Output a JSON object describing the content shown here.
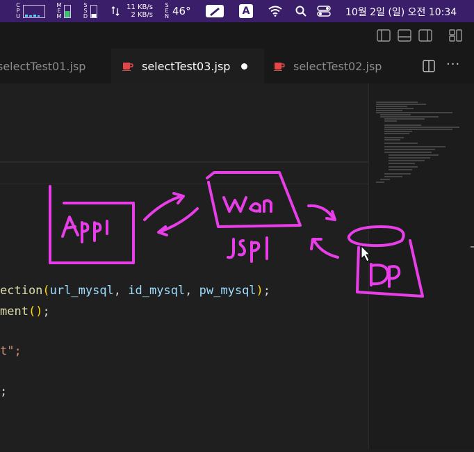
{
  "menubar": {
    "cpu_label": "CPU",
    "mem_label": "MEM",
    "ssd_label": "SSD",
    "net_up": "11 KB/s",
    "net_down": "2 KB/s",
    "sen_label": "SEN",
    "temperature": "46°",
    "input_mode": "A",
    "datetime": "10월 2일 (일) 오전 10:34"
  },
  "tabs": [
    {
      "label": "selectTest01.jsp",
      "active": false
    },
    {
      "label": "selectTest03.jsp",
      "active": true,
      "modified": true
    },
    {
      "label": "selectTest02.jsp",
      "active": false
    }
  ],
  "code": {
    "line1": {
      "fn": "ection",
      "args": [
        "url_mysql",
        "id_mysql",
        "pw_mysql"
      ]
    },
    "line2": {
      "fn": "ment"
    },
    "line3": {
      "text": "t\";"
    },
    "line4": {
      "text": ";"
    }
  },
  "annotation": {
    "app": "App",
    "was": "WAS",
    "jsp": "JSP",
    "db": "DB"
  },
  "colors": {
    "menubar": "#3b1e6a",
    "editor_bg": "#1f1f1f",
    "pen": "#e83ee8",
    "jsp_icon": "#e04848"
  }
}
